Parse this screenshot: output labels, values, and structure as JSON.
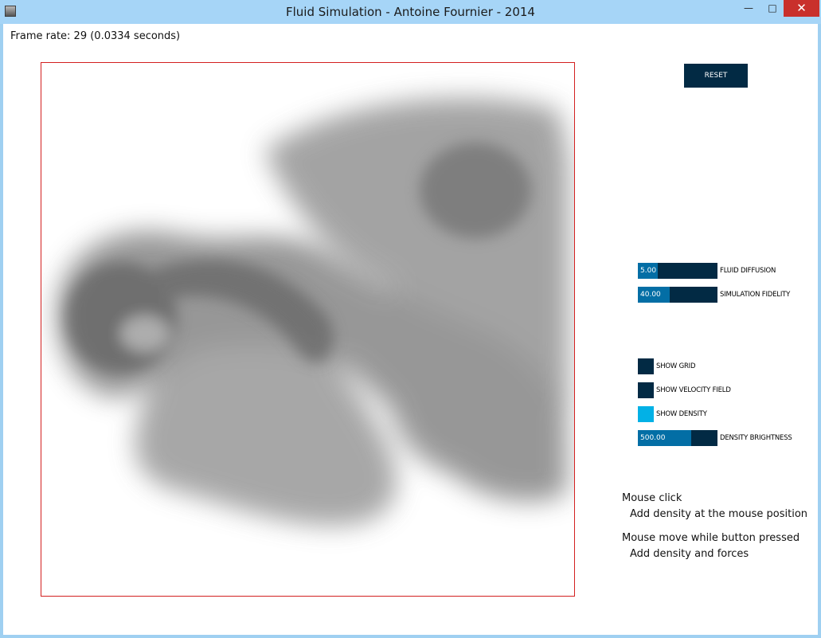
{
  "window": {
    "title": "Fluid Simulation - Antoine Fournier - 2014",
    "minimize_glyph": "—",
    "maximize_glyph": "□",
    "close_glyph": "✕"
  },
  "status": {
    "frame_rate": "Frame rate: 29 (0.0334 seconds)"
  },
  "buttons": {
    "reset": "RESET"
  },
  "sliders": [
    {
      "value": "5.00",
      "label": "FLUID DIFFUSION",
      "fill_fraction": 0.25
    },
    {
      "value": "40.00",
      "label": "SIMULATION FIDELITY",
      "fill_fraction": 0.4
    },
    {
      "value": "500.00",
      "label": "DENSITY BRIGHTNESS",
      "fill_fraction": 0.67
    }
  ],
  "toggles": [
    {
      "label": "SHOW GRID",
      "on": false
    },
    {
      "label": "SHOW VELOCITY FIELD",
      "on": false
    },
    {
      "label": "SHOW DENSITY",
      "on": true
    }
  ],
  "help": {
    "click_title": "Mouse click",
    "click_desc": "Add density at the mouse position",
    "drag_title": "Mouse move while button pressed",
    "drag_desc": "Add density and forces"
  },
  "colors": {
    "control_dark": "#022a44",
    "slider_fill": "#036ea5",
    "toggle_on": "#02b1e6",
    "sim_border": "#d32020"
  }
}
